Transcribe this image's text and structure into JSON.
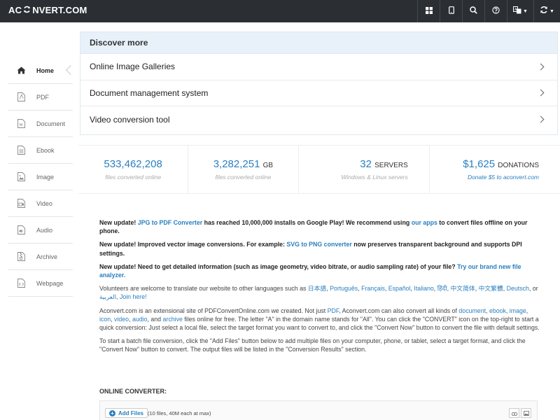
{
  "header": {
    "logo_left": "AC",
    "logo_right": "NVERT.COM",
    "nav_icons": [
      "grid-icon",
      "tablet-icon",
      "search-icon",
      "help-icon",
      "language-icon",
      "refresh-icon"
    ]
  },
  "sidebar": {
    "items": [
      {
        "label": "Home",
        "icon": "home-icon"
      },
      {
        "label": "PDF",
        "icon": "pdf-file-icon"
      },
      {
        "label": "Document",
        "icon": "document-file-icon"
      },
      {
        "label": "Ebook",
        "icon": "ebook-file-icon"
      },
      {
        "label": "Image",
        "icon": "image-file-icon"
      },
      {
        "label": "Video",
        "icon": "video-file-icon"
      },
      {
        "label": "Audio",
        "icon": "audio-file-icon"
      },
      {
        "label": "Archive",
        "icon": "archive-file-icon"
      },
      {
        "label": "Webpage",
        "icon": "webpage-file-icon"
      }
    ]
  },
  "discover": {
    "title": "Discover more",
    "rows": [
      "Online Image Galleries",
      "Document management system",
      "Video conversion tool"
    ]
  },
  "stats": [
    {
      "value": "533,462,208",
      "unit": "",
      "sub": "files converted online"
    },
    {
      "value": "3,282,251",
      "unit": "GB",
      "sub": "files converted online"
    },
    {
      "value": "32",
      "unit": "SERVERS",
      "sub": "Windows & Linux servers"
    },
    {
      "value": "$1,625",
      "unit": "DONATIONS",
      "sub": "Donate $5 to aconvert.com"
    }
  ],
  "content": {
    "u1_a": "New update! ",
    "u1_link1": "JPG to PDF Converter",
    "u1_b": " has reached 10,000,000 installs on Google Play! We recommend using ",
    "u1_link2": "our apps",
    "u1_c": " to convert files offline on your phone.",
    "u2_a": "New update! Improved vector image conversions. For example: ",
    "u2_link": "SVG to PNG converter",
    "u2_b": " now preserves transparent background and supports DPI settings.",
    "u3_a": "New update! Need to get detailed information (such as image geometry, video bitrate, or audio sampling rate) of your file? ",
    "u3_link": "Try our brand new file analyzer.",
    "vol_a": "Volunteers are welcome to translate our website to other languages such as ",
    "languages": [
      "日本語",
      "Português",
      "Français",
      "Español",
      "Italiano",
      "हिंदी",
      "中文简体",
      "中文繁體",
      "Deutsch",
      "العربية"
    ],
    "vol_or": ", or ",
    "vol_join": "Join here!",
    "about_a": "Aconvert.com is an extensional site of PDFConvertOnline.com we created. Not just ",
    "about_pdf": "PDF",
    "about_b": ", Aconvert.com can also convert all kinds of ",
    "about_document": "document",
    "about_ebook": "ebook",
    "about_image": "image",
    "about_icon": "icon",
    "about_video": "video",
    "about_audio": "audio",
    "about_and": ", and ",
    "about_archive": "archive",
    "about_c": " files online for free. The letter \"A\" in the domain name stands for \"All\". You can click the \"CONVERT\" icon on the top-right to start a quick conversion: Just select a local file, select the target format you want to convert to, and click the \"Convert Now\" button to convert the file with default settings.",
    "batch": "To start a batch file conversion, click the \"Add Files\" button below to add multiple files on your computer, phone, or tablet, select a target format, and click the \"Convert Now\" button to convert. The output files will be listed in the \"Conversion Results\" section."
  },
  "converter": {
    "label": "ONLINE CONVERTER:",
    "add_files": "Add Files",
    "note": "(10 files, 40M each at max)"
  }
}
